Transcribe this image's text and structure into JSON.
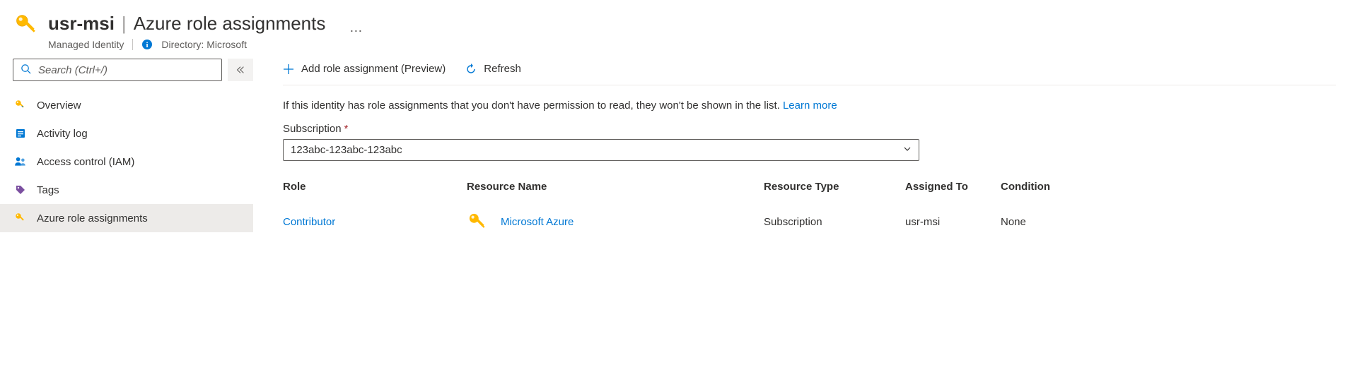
{
  "header": {
    "resource_name": "usr-msi",
    "separator": "|",
    "page_title": "Azure role assignments",
    "resource_type": "Managed Identity",
    "directory_label": "Directory:",
    "directory_value": "Microsoft"
  },
  "sidebar": {
    "search_placeholder": "Search (Ctrl+/)",
    "items": [
      {
        "label": "Overview"
      },
      {
        "label": "Activity log"
      },
      {
        "label": "Access control (IAM)"
      },
      {
        "label": "Tags"
      },
      {
        "label": "Azure role assignments"
      }
    ]
  },
  "toolbar": {
    "add_label": "Add role assignment (Preview)",
    "refresh_label": "Refresh"
  },
  "main": {
    "note_text": "If this identity has role assignments that you don't have permission to read, they won't be shown in the list.",
    "learn_more_label": "Learn more",
    "subscription_label": "Subscription",
    "subscription_value": "123abc-123abc-123abc"
  },
  "table": {
    "headers": {
      "role": "Role",
      "resource_name": "Resource Name",
      "resource_type": "Resource Type",
      "assigned_to": "Assigned To",
      "condition": "Condition"
    },
    "rows": [
      {
        "role": "Contributor",
        "resource_name": "Microsoft Azure",
        "resource_type": "Subscription",
        "assigned_to": "usr-msi",
        "condition": "None"
      }
    ]
  }
}
